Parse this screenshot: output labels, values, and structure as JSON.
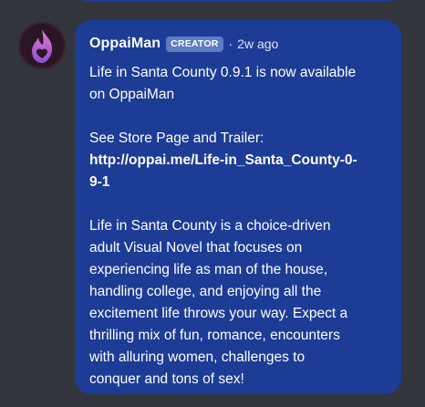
{
  "message": {
    "author": "OppaiMan",
    "badge": "CREATOR",
    "separator": "·",
    "timestamp": "2w ago",
    "avatar_icon": "flame-heart-icon",
    "colors": {
      "background": "#32353b",
      "bubble": "#1c3c96",
      "badge": "#5e7cc2",
      "avatar_flame": "#b86cd8"
    },
    "paragraph1_line1": "Life in Santa County 0.9.1 is now available",
    "paragraph1_line2": "on OppaiMan",
    "paragraph2_label": "See Store Page and Trailer:",
    "link_line1": "http://oppai.me/Life-in_Santa_County-0-",
    "link_line2": "9-1",
    "paragraph3_lines": [
      "Life in Santa County is a choice-driven",
      "adult Visual Novel that focuses on",
      "experiencing life as man of the house,",
      "handling college, and enjoying all the",
      "excitement life throws your way. Expect a",
      "thrilling mix of fun, romance, encounters",
      "with alluring women, challenges to",
      "conquer and tons of sex!"
    ]
  }
}
